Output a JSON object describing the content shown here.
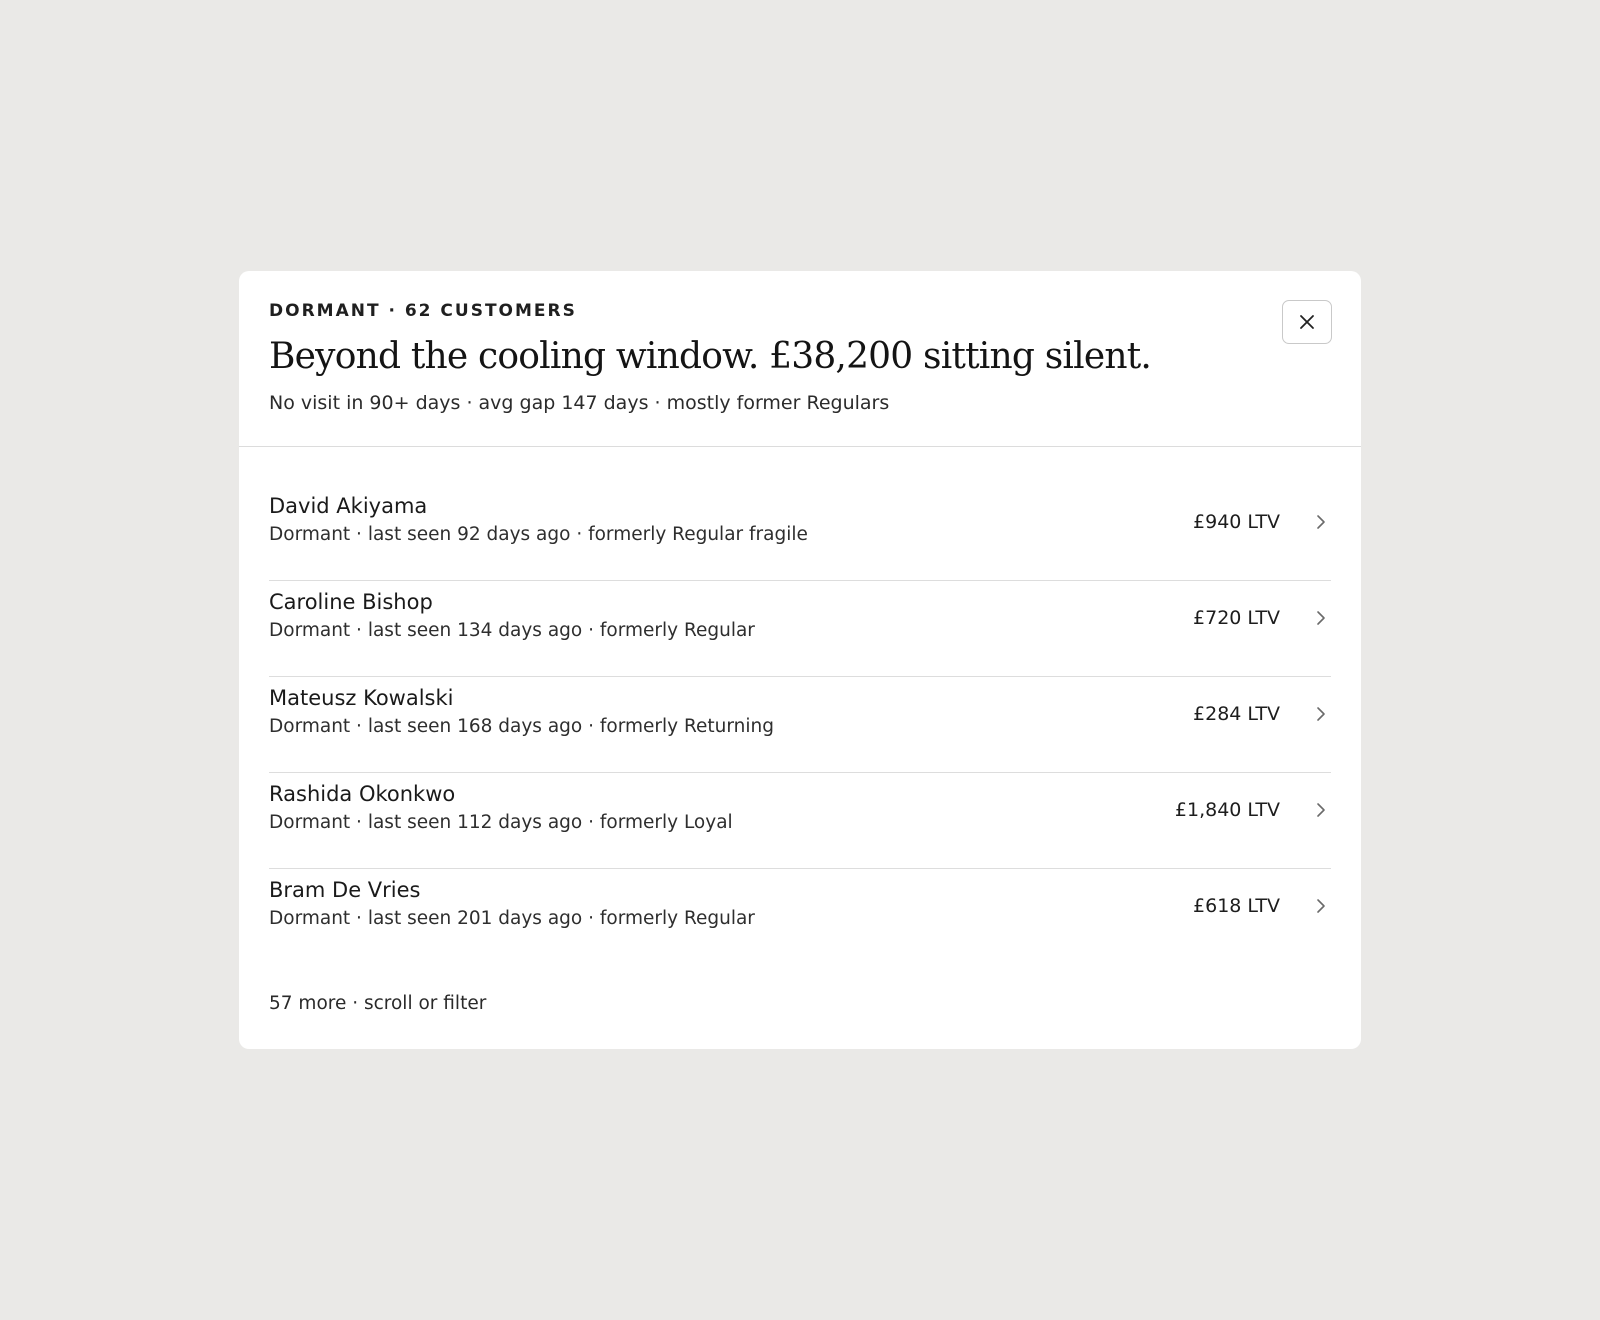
{
  "modal": {
    "eyebrow": "DORMANT · 62 CUSTOMERS",
    "headline": "Beyond the cooling window. £38,200 sitting silent.",
    "subline": "No visit in 90+ days · avg gap 147 days · mostly former Regulars",
    "close_icon": "close-icon",
    "footer_note": "57 more · scroll or filter"
  },
  "customers": [
    {
      "name": "David Akiyama",
      "meta": "Dormant · last seen 92 days ago · formerly Regular fragile",
      "ltv": "£940 LTV"
    },
    {
      "name": "Caroline Bishop",
      "meta": "Dormant · last seen 134 days ago · formerly Regular",
      "ltv": "£720 LTV"
    },
    {
      "name": "Mateusz Kowalski",
      "meta": "Dormant · last seen 168 days ago · formerly Returning",
      "ltv": "£284 LTV"
    },
    {
      "name": "Rashida Okonkwo",
      "meta": "Dormant · last seen 112 days ago · formerly Loyal",
      "ltv": "£1,840 LTV"
    },
    {
      "name": "Bram De Vries",
      "meta": "Dormant · last seen 201 days ago · formerly Regular",
      "ltv": "£618 LTV"
    }
  ],
  "colors": {
    "page_background": "#eae9e7",
    "panel_background": "#ffffff",
    "divider": "#dddddd",
    "text": "#1c1c1c"
  }
}
